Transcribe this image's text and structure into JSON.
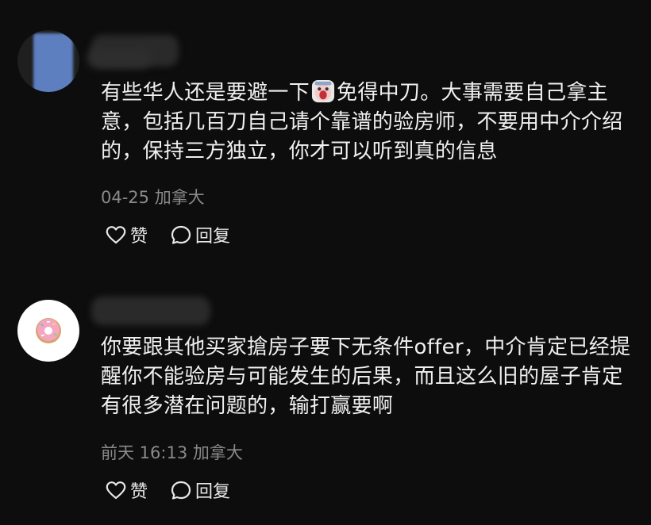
{
  "comments": [
    {
      "text_before_emoji": "有些华人还是要避一下",
      "emoji": "scream-face-icon",
      "text_after_emoji": "免得中刀。大事需要自己拿主意，包括几百刀自己请个靠谱的验房师，不要用中介介绍的，保持三方独立，你才可以听到真的信息",
      "time": "04-25",
      "location": "加拿大",
      "like_label": "赞",
      "reply_label": "回复"
    },
    {
      "text": "你要跟其他买家搶房子要下无条件offer，中介肯定已经提醒你不能验房与可能发生的后果，而且这么旧的屋子肯定有很多潜在问题的，输打赢要啊",
      "time": "前天 16:13",
      "location": "加拿大",
      "like_label": "赞",
      "reply_label": "回复",
      "avatar_icon": "donut-icon"
    }
  ]
}
